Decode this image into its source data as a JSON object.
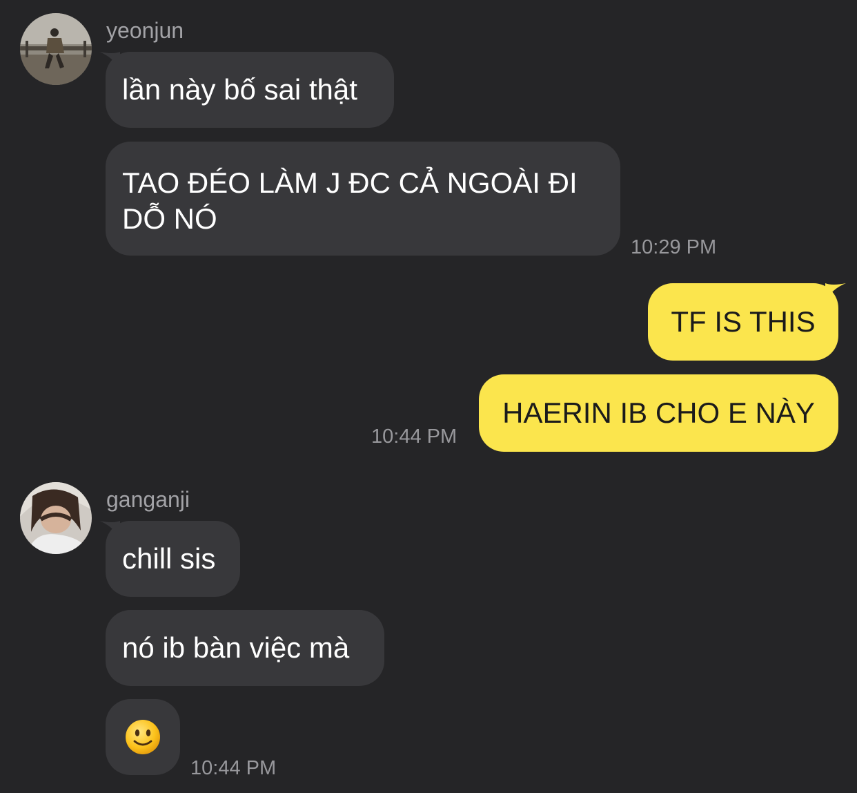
{
  "colors": {
    "background": "#252527",
    "incoming_bubble": "#38383b",
    "outgoing_bubble": "#fbe54d",
    "incoming_text": "#ffffff",
    "outgoing_text": "#1b1b1b",
    "meta_text": "#98989c"
  },
  "groups": [
    {
      "sender": "yeonjun",
      "avatar_icon": "profile-photo-icon",
      "messages": [
        {
          "text": "lần này bố sai thật"
        },
        {
          "text": "TAO ĐÉO LÀM J ĐC CẢ NGOÀI ĐI DỖ NÓ"
        }
      ],
      "time": "10:29 PM"
    },
    {
      "sender": "me",
      "messages": [
        {
          "text": "TF IS THIS"
        },
        {
          "text": "HAERIN IB CHO E NÀY"
        }
      ],
      "time": "10:44 PM"
    },
    {
      "sender": "ganganji",
      "avatar_icon": "profile-photo-icon",
      "messages": [
        {
          "text": "chill sis"
        },
        {
          "text": "nó ib bàn việc mà"
        },
        {
          "emoji": "slightly-smiling-face-icon"
        }
      ],
      "time": "10:44 PM"
    }
  ]
}
